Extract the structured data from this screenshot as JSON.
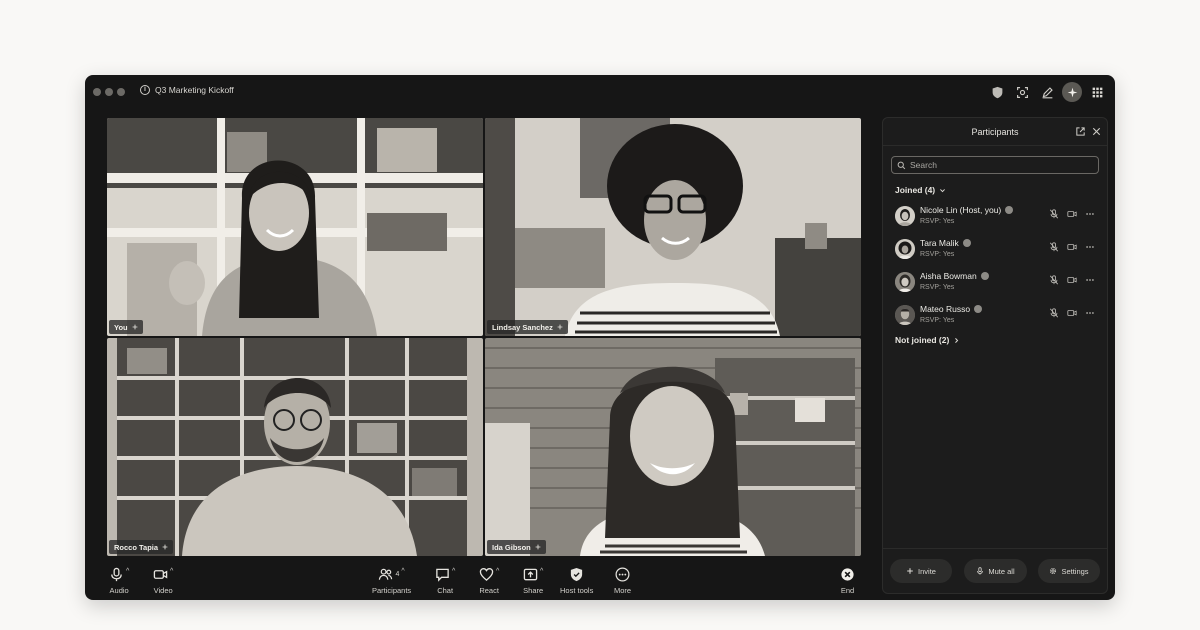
{
  "meeting": {
    "title": "Q3 Marketing Kickoff"
  },
  "titlebar_icons": [
    "shield-icon",
    "screen-capture-icon",
    "pen-icon",
    "ai-assistant-icon",
    "apps-grid-icon"
  ],
  "tiles": [
    {
      "name": "You"
    },
    {
      "name": "Lindsay Sanchez"
    },
    {
      "name": "Rocco Tapia"
    },
    {
      "name": "Ida Gibson"
    }
  ],
  "controls": {
    "audio": "Audio",
    "video": "Video",
    "participants": "Participants",
    "participants_count": "4",
    "chat": "Chat",
    "react": "React",
    "share": "Share",
    "host_tools": "Host tools",
    "more": "More",
    "end": "End"
  },
  "panel": {
    "title": "Participants",
    "search_placeholder": "Search",
    "joined_header": "Joined (4)",
    "not_joined_header": "Not joined (2)",
    "participants": [
      {
        "name": "Nicole Lin (Host, you)",
        "rsvp": "RSVP: Yes"
      },
      {
        "name": "Tara Malik",
        "rsvp": "RSVP: Yes"
      },
      {
        "name": "Aisha Bowman",
        "rsvp": "RSVP: Yes"
      },
      {
        "name": "Mateo Russo",
        "rsvp": "RSVP: Yes"
      }
    ],
    "buttons": {
      "invite": "Invite",
      "mute_all": "Mute all",
      "settings": "Settings"
    }
  },
  "colors": {
    "window_bg": "#161616",
    "panel_bg": "#1c1c1c",
    "page_bg": "#f9f8f6",
    "text_primary": "#e9e7e2"
  }
}
